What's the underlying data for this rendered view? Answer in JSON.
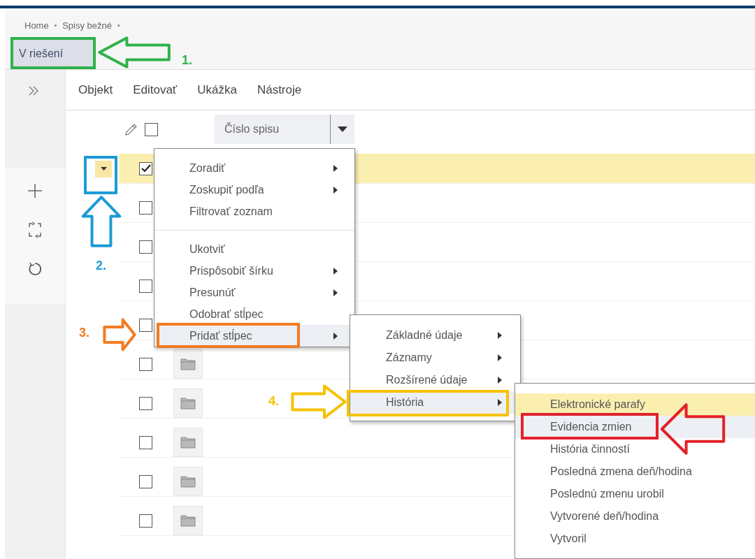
{
  "breadcrumb": {
    "items": [
      "Home",
      "Spisy bežné"
    ],
    "separator": "•"
  },
  "tabs": [
    {
      "label": "V riešení",
      "selected": true
    }
  ],
  "menu_bar": [
    "Objekt",
    "Editovať",
    "Ukážka",
    "Nástroje"
  ],
  "table": {
    "header_checked": false,
    "columns": [
      {
        "label": "Číslo spisu"
      }
    ],
    "rows": [
      {
        "checked": true,
        "selected": true
      },
      {
        "checked": false,
        "selected": false
      },
      {
        "checked": false,
        "selected": false
      },
      {
        "checked": false,
        "selected": false
      },
      {
        "checked": false,
        "selected": false
      },
      {
        "checked": false,
        "selected": false,
        "folder_icon": true
      },
      {
        "checked": false,
        "selected": false,
        "folder_icon": true
      },
      {
        "checked": false,
        "selected": false,
        "folder_icon": true
      },
      {
        "checked": false,
        "selected": false,
        "folder_icon": true
      },
      {
        "checked": false,
        "selected": false,
        "folder_icon": true
      }
    ]
  },
  "context_menu": {
    "groups": [
      [
        {
          "label": "Zoradiť",
          "submenu": true,
          "selected": false
        },
        {
          "label": "Zoskupiť podľa",
          "submenu": true,
          "selected": false
        },
        {
          "label": "Filtrovať zoznam",
          "submenu": false,
          "selected": false
        }
      ],
      [
        {
          "label": "Ukotviť",
          "submenu": false,
          "selected": false
        },
        {
          "label": "Prispôsobiť šírku",
          "submenu": true,
          "selected": false
        },
        {
          "label": "Presunúť",
          "submenu": true,
          "selected": false
        },
        {
          "label": "Odobrať stĺpec",
          "submenu": false,
          "selected": false
        },
        {
          "label": "Pridať stĺpec",
          "submenu": true,
          "selected": true
        }
      ]
    ]
  },
  "submenu": {
    "items": [
      {
        "label": "Základné údaje",
        "submenu": true,
        "selected": false
      },
      {
        "label": "Záznamy",
        "submenu": true,
        "selected": false
      },
      {
        "label": "Rozšírené údaje",
        "submenu": true,
        "selected": false
      },
      {
        "label": "História",
        "submenu": true,
        "selected": true
      }
    ]
  },
  "history_submenu": {
    "items": [
      {
        "label": "Elektronické parafy",
        "selected": false,
        "hovered": true
      },
      {
        "label": "Evidencia zmien",
        "selected": true,
        "hovered": false
      },
      {
        "label": "História činností",
        "selected": false,
        "hovered": false
      },
      {
        "label": "Posledná zmena deň/hodina",
        "selected": false,
        "hovered": false
      },
      {
        "label": "Poslednú zmenu urobil",
        "selected": false,
        "hovered": false
      },
      {
        "label": "Vytvorené deň/hodina",
        "selected": false,
        "hovered": false
      },
      {
        "label": "Vytvoril",
        "selected": false,
        "hovered": false
      }
    ]
  },
  "annotations": [
    {
      "label": "1.",
      "color": "#2fb24a"
    },
    {
      "label": "2.",
      "color": "#1b9ad6"
    },
    {
      "label": "3.",
      "color": "#f47c22"
    },
    {
      "label": "4.",
      "color": "#f6c200"
    },
    {
      "color": "#e3212b"
    }
  ]
}
